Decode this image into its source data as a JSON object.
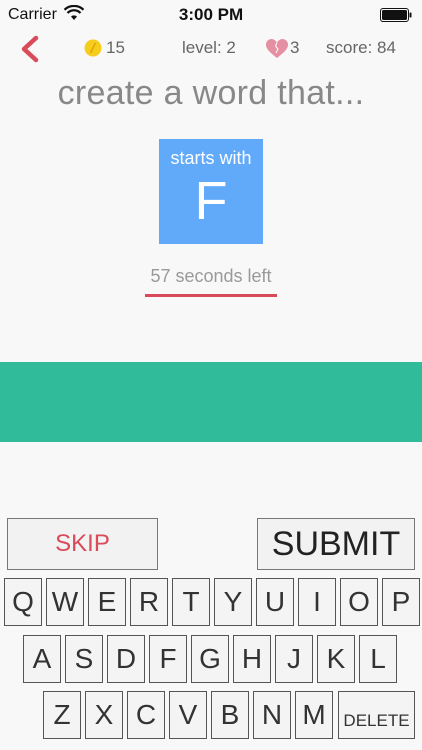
{
  "status_bar": {
    "carrier": "Carrier",
    "time": "3:00 PM"
  },
  "header": {
    "coins": "15",
    "level": "level: 2",
    "lives": "3",
    "score": "score: 84"
  },
  "prompt": "create a word that...",
  "card": {
    "rule": "starts with",
    "letter": "F",
    "color": "#61aafa"
  },
  "timer": "57 seconds left",
  "answer_bar_color": "#30bc9b",
  "actions": {
    "skip": "SKIP",
    "submit": "SUBMIT"
  },
  "keyboard": {
    "row1": [
      "Q",
      "W",
      "E",
      "R",
      "T",
      "Y",
      "U",
      "I",
      "O",
      "P"
    ],
    "row2": [
      "A",
      "S",
      "D",
      "F",
      "G",
      "H",
      "J",
      "K",
      "L"
    ],
    "row3": [
      "Z",
      "X",
      "C",
      "V",
      "B",
      "N",
      "M"
    ],
    "delete": "DELETE"
  }
}
